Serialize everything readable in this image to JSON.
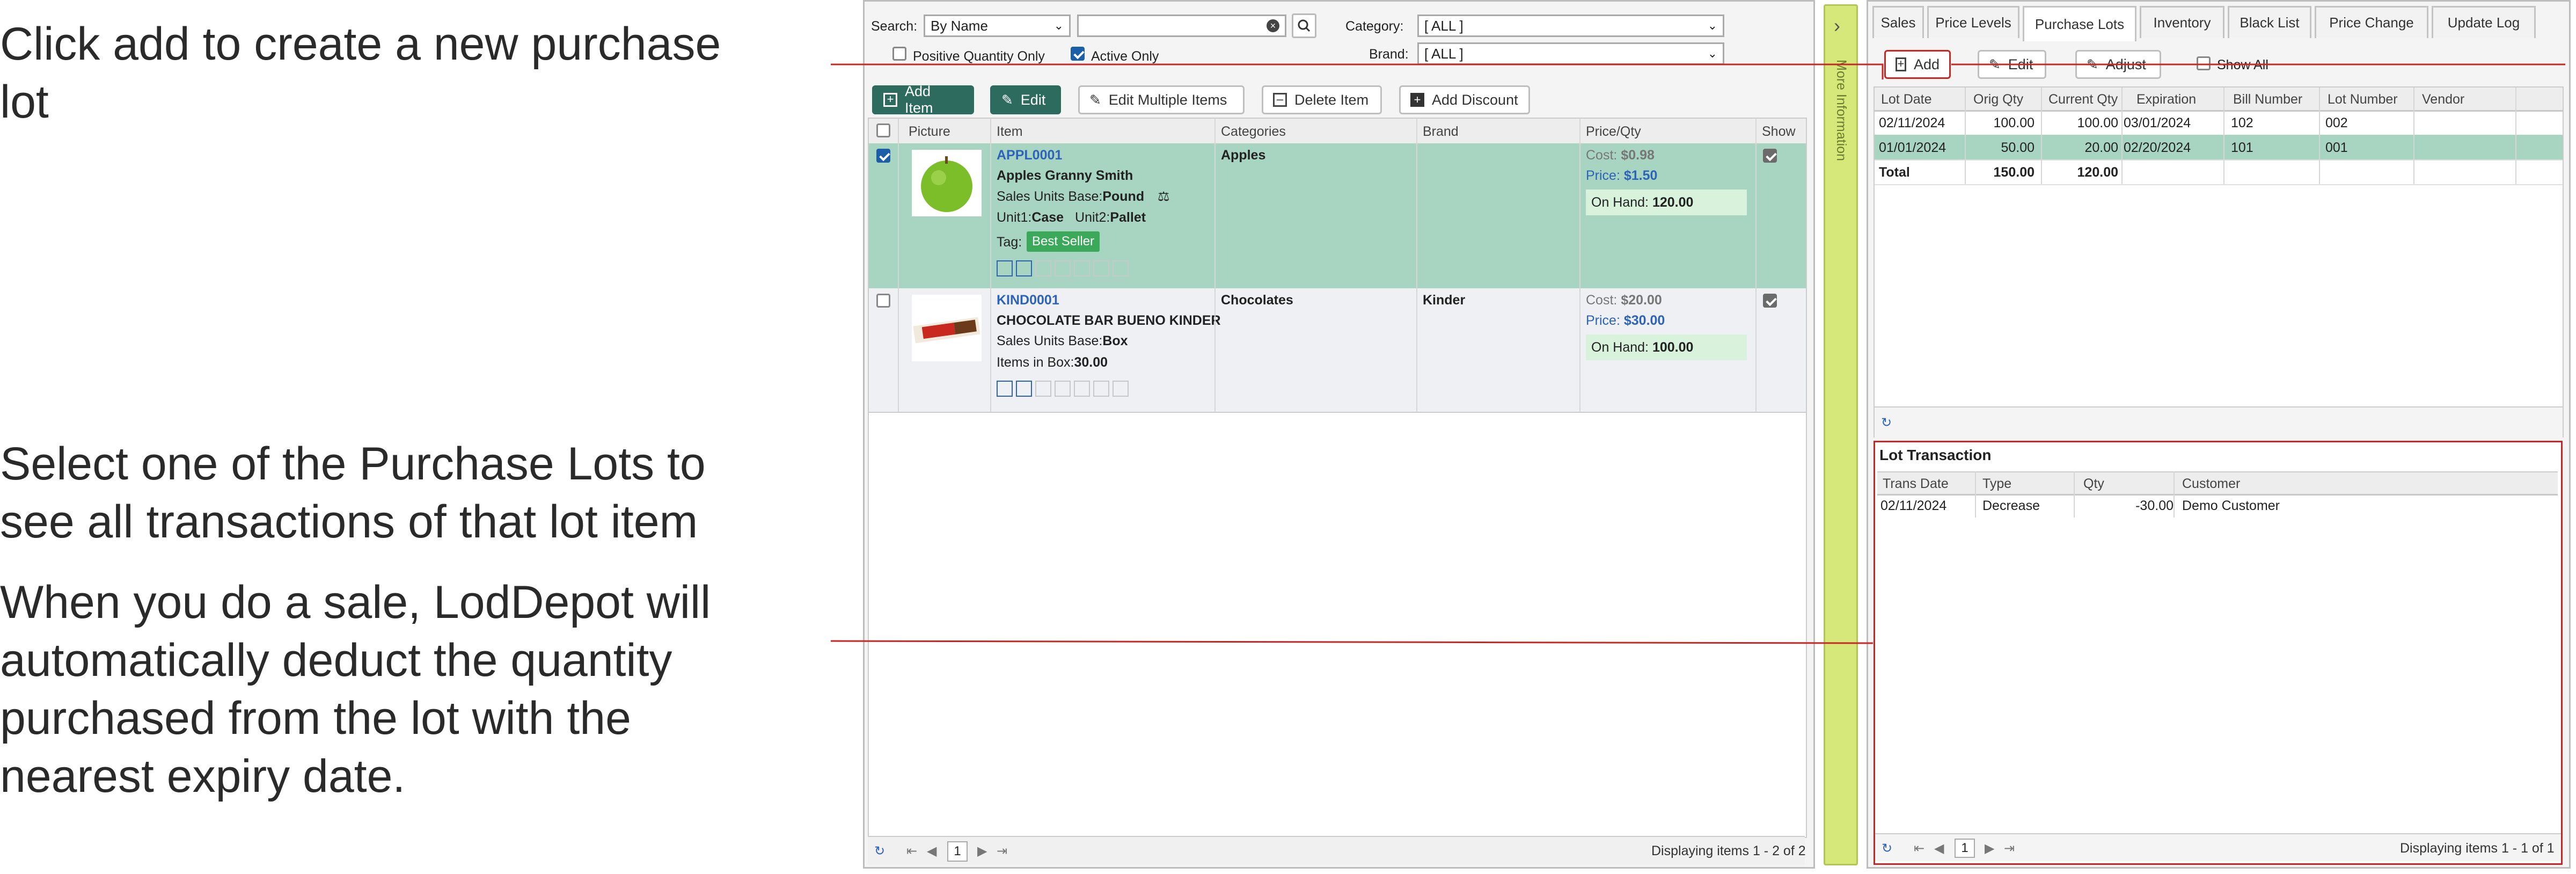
{
  "annotations": {
    "note1": [
      "Click add to create a new purchase",
      "lot"
    ],
    "note2": [
      "Select one of the Purchase Lots to",
      "see all transactions of that lot item"
    ],
    "note3": [
      "When you do a sale, LodDepot will",
      "automatically deduct the quantity",
      "purchased from the lot with the",
      "nearest expiry date."
    ]
  },
  "colors": {
    "annotation_line": "#c62828",
    "selected_row": "#a8d5c1",
    "panel_toggle": "#d7e87a",
    "accent": "#2e6b5f"
  },
  "toolbar": {
    "search_label": "Search:",
    "search_mode": "By Name",
    "search_value": "",
    "category_label": "Category:",
    "category_value": "[ ALL ]",
    "brand_label": "Brand:",
    "brand_value": "[ ALL ]",
    "positive_qty_label": "Positive Quantity Only",
    "positive_qty_checked": false,
    "active_only_label": "Active Only",
    "active_only_checked": true
  },
  "actions": {
    "add_item": "Add Item",
    "edit": "Edit",
    "edit_multiple": "Edit Multiple Items",
    "delete_item": "Delete Item",
    "add_discount": "Add Discount"
  },
  "grid": {
    "columns": [
      "Picture",
      "Item",
      "Categories",
      "Brand",
      "Price/Qty",
      "Show"
    ],
    "rows": [
      {
        "code": "APPL0001",
        "name": "Apples Granny Smith",
        "sales_units_label": "Sales Units Base:",
        "sales_units": "Pound",
        "unit1_label": "Unit1:",
        "unit1": "Case",
        "unit2_label": "Unit2:",
        "unit2": "Pallet",
        "tag_label": "Tag:",
        "tag": "Best Seller",
        "category": "Apples",
        "brand": "",
        "cost_label": "Cost:",
        "cost": "$0.98",
        "price_label": "Price:",
        "price": "$1.50",
        "onhand_label": "On Hand:",
        "onhand": "120.00",
        "selected": true,
        "show": true
      },
      {
        "code": "KIND0001",
        "name": "CHOCOLATE BAR BUENO KINDER",
        "sales_units_label": "Sales Units Base:",
        "sales_units": "Box",
        "items_label": "Items in Box:",
        "items": "30.00",
        "category": "Chocolates",
        "brand": "Kinder",
        "cost_label": "Cost:",
        "cost": "$20.00",
        "price_label": "Price:",
        "price": "$30.00",
        "onhand_label": "On Hand:",
        "onhand": "100.00",
        "selected": false,
        "show": true
      }
    ],
    "pager": {
      "page": "1",
      "display": "Displaying items 1 - 2 of 2"
    }
  },
  "side_toggle": {
    "label": "More Information"
  },
  "tabs": [
    "Sales",
    "Price Levels",
    "Purchase Lots",
    "Inventory",
    "Black List",
    "Price Change",
    "Update Log"
  ],
  "active_tab": "Purchase Lots",
  "lots": {
    "buttons": {
      "add": "Add",
      "edit": "Edit",
      "adjust": "Adjust",
      "show_all": "Show All"
    },
    "columns": [
      "Lot Date",
      "Orig Qty",
      "Current Qty",
      "Expiration",
      "Bill Number",
      "Lot Number",
      "Vendor"
    ],
    "rows": [
      [
        "02/11/2024",
        "100.00",
        "100.00",
        "03/01/2024",
        "102",
        "002",
        ""
      ],
      [
        "01/01/2024",
        "50.00",
        "20.00",
        "02/20/2024",
        "101",
        "001",
        ""
      ]
    ],
    "total": [
      "Total",
      "150.00",
      "120.00",
      "",
      "",
      "",
      ""
    ]
  },
  "lot_transaction": {
    "title": "Lot Transaction",
    "columns": [
      "Trans Date",
      "Type",
      "Qty",
      "Customer"
    ],
    "rows": [
      [
        "02/11/2024",
        "Decrease",
        "-30.00",
        "Demo Customer"
      ]
    ],
    "pager": {
      "page": "1",
      "display": "Displaying items 1 - 1 of 1"
    }
  }
}
